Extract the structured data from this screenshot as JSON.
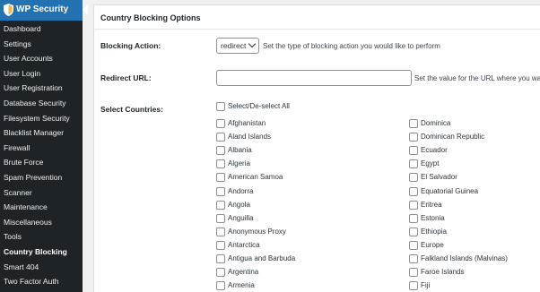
{
  "sidebar": {
    "header_title": "WP Security",
    "items": [
      {
        "label": "Dashboard"
      },
      {
        "label": "Settings"
      },
      {
        "label": "User Accounts"
      },
      {
        "label": "User Login"
      },
      {
        "label": "User Registration"
      },
      {
        "label": "Database Security"
      },
      {
        "label": "Filesystem Security"
      },
      {
        "label": "Blacklist Manager"
      },
      {
        "label": "Firewall"
      },
      {
        "label": "Brute Force"
      },
      {
        "label": "Spam Prevention"
      },
      {
        "label": "Scanner"
      },
      {
        "label": "Maintenance"
      },
      {
        "label": "Miscellaneous"
      },
      {
        "label": "Tools"
      },
      {
        "label": "Country Blocking"
      },
      {
        "label": "Smart 404"
      },
      {
        "label": "Two Factor Auth"
      }
    ],
    "active_item": "Country Blocking",
    "colors": {
      "background": "#1d2327",
      "header": "#2271b1"
    }
  },
  "main": {
    "section_title": "Country Blocking Options",
    "blocking_action": {
      "label": "Blocking Action:",
      "selected": "redirect",
      "description": "Set the type of blocking action you would like to perform"
    },
    "redirect_url": {
      "label": "Redirect URL:",
      "value": "",
      "description": "Set the value for the URL where you want"
    },
    "select_countries": {
      "label": "Select Countries:",
      "select_all_label": "Select/De-select All",
      "col1": [
        "Afghanistan",
        "Aland Islands",
        "Albania",
        "Algeria",
        "American Samoa",
        "Andorra",
        "Angola",
        "Anguilla",
        "Anonymous Proxy",
        "Antarctica",
        "Antigua and Barbuda",
        "Argentina",
        "Armenia"
      ],
      "col2": [
        "Dominica",
        "Dominican Republic",
        "Ecuador",
        "Egypt",
        "El Salvador",
        "Equatorial Guinea",
        "Eritrea",
        "Estonia",
        "Ethiopia",
        "Europe",
        "Falkland Islands (Malvinas)",
        "Faroe Islands",
        "Fiji"
      ]
    }
  }
}
